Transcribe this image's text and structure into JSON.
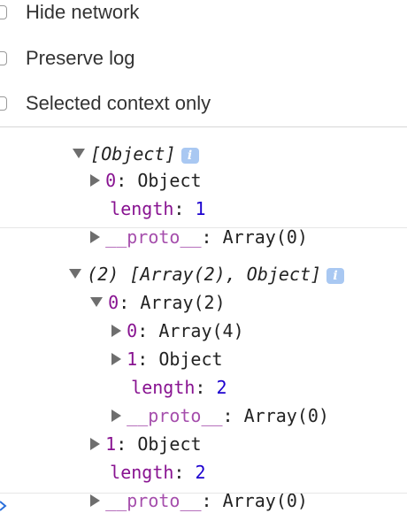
{
  "settings": {
    "options": [
      {
        "label": "Hide network",
        "checked": false
      },
      {
        "label": "Preserve log",
        "checked": false
      },
      {
        "label": "Selected context only",
        "checked": false
      }
    ]
  },
  "console": {
    "group1": {
      "header_partial": "[Object]",
      "items": [
        {
          "key": "0",
          "value": "Object"
        },
        {
          "key": "length",
          "value": "1"
        },
        {
          "key": "__proto__",
          "value": "Array(0)"
        }
      ]
    },
    "group2": {
      "header": "(2) [Array(2), Object]",
      "item0": {
        "key": "0",
        "value": "Array(2)"
      },
      "item0_children": [
        {
          "key": "0",
          "value": "Array(4)"
        },
        {
          "key": "1",
          "value": "Object"
        },
        {
          "key": "length",
          "value": "2"
        },
        {
          "key": "__proto__",
          "value": "Array(0)"
        }
      ],
      "item1": {
        "key": "1",
        "value": "Object"
      },
      "length": {
        "key": "length",
        "value": "2"
      },
      "proto": {
        "key": "__proto__",
        "value": "Array(0)"
      }
    },
    "info_icon": "i",
    "colors": {
      "key": "#881391",
      "number": "#1c00cf",
      "info": "#a9c8f2"
    }
  }
}
